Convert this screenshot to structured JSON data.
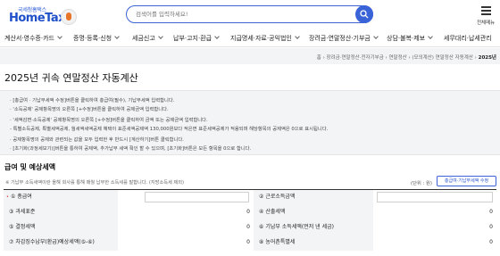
{
  "header": {
    "logo_small": "국세청홈택스",
    "logo_main": "HomeTax",
    "search_placeholder": "검색어를 입력하세요!",
    "menu_label": "전체메뉴"
  },
  "gnb": [
    {
      "label": "계산서·영수증·카드"
    },
    {
      "label": "증명·등록·신청"
    },
    {
      "label": "세금신고"
    },
    {
      "label": "납부·고지·환급"
    },
    {
      "label": "지급명세·자료·공익법인"
    },
    {
      "label": "장려금·연말정산·기부금"
    },
    {
      "label": "상담·불복·제보"
    },
    {
      "label": "세무대리·납세관리"
    }
  ],
  "breadcrumb": [
    "홈",
    "장려금·연말정산·전자기부금",
    "연말정산",
    "(모의계산) 연말정산 자동계산",
    "2025년"
  ],
  "page_title": "2025년 귀속 연말정산 자동계산",
  "notice": [
    "· [총급여 · 기납부세액 수정]버튼을 클릭하여 총급여(필수), 기납부세액 입력합니다.",
    "· '소득공제' 공제항목명의 오른쪽 [+수정]버튼을 클릭하여 공제금액 입력합니다.",
    "· '세액감면·소득공제' 공제항목명의 오른쪽 [+수정]버튼을 클릭하여 금액 또는 공제금액 입력합니다.",
    "  - 특별소득공제, 특별세액공제, 월세액세액공제 혜택이 표준세액공제액 130,000원보다 적은면 표준세액공제가 적용되며 해당항목의 공제액은 0으로 표시됩니다.",
    "· 공제항목명의 공제와 관련되는 값을 모두 입력한 후 반드시 [계산하기]버튼 클릭합니다.",
    "· [초기화(과정세보기)]버튼을 통하여 공제액, 추가납부 세액 확인 할 수 있으며, [초기화]버튼은 모든 항목을 0으로 합니다."
  ],
  "section": {
    "title": "급여 및 예상세액",
    "note": "※ 기납부 소득세액이란 올해 회사를 통해 매월 납부한 소득세를 말합니다. (지방소득세 제외)",
    "unit": "(단위 : 원)",
    "calc_button": "총급여·기납부세액 수정"
  },
  "rows": [
    {
      "left": {
        "num": "①",
        "label": "총급여",
        "required": true,
        "value": ""
      },
      "right": {
        "num": "②",
        "label": "근로소득금액",
        "value": ""
      }
    },
    {
      "left": {
        "num": "③",
        "label": "과세표준",
        "value": "0"
      },
      "right": {
        "num": "④",
        "label": "산출세액",
        "value": "0"
      }
    },
    {
      "left": {
        "num": "⑤",
        "label": "결정세액",
        "value": "0"
      },
      "right": {
        "num": "⑥",
        "label": "기납부 소득세액(먼저 낸 세금)",
        "value": "0"
      }
    },
    {
      "left": {
        "num": "⑦",
        "label": "차감징수납부(환급)예상세액(⑤-⑥)",
        "value": "0"
      },
      "right": {
        "num": "⑧",
        "label": "농어촌특별세",
        "value": "0"
      }
    }
  ],
  "colors": {
    "brand": "#1f4fc9",
    "accent": "#3b63d8",
    "required": "#e03a3a"
  }
}
